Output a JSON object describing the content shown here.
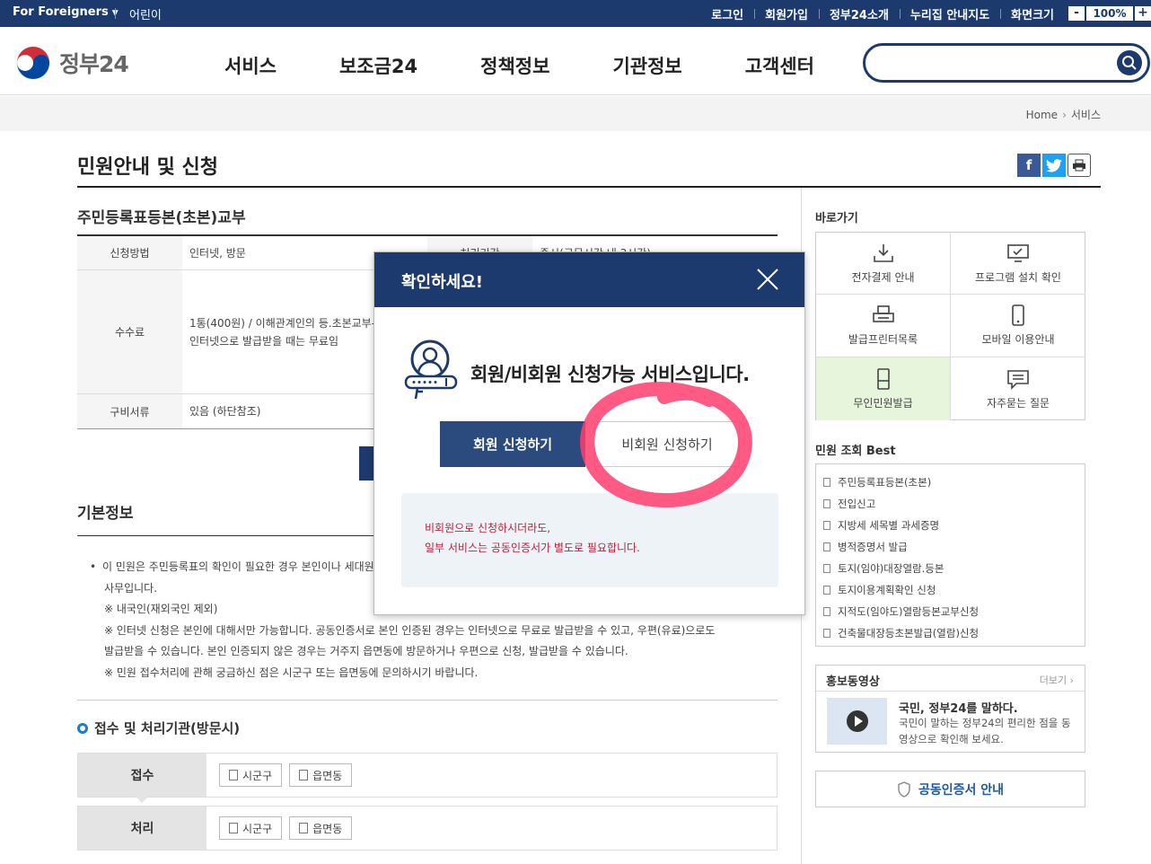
{
  "topbar": {
    "language": "For Foreigners",
    "kids": "어린이",
    "utilities": [
      "로그인",
      "회원가입",
      "정부24소개",
      "누리집 안내지도",
      "화면크기"
    ],
    "zoom": {
      "minus": "-",
      "value": "100%",
      "plus": "+"
    }
  },
  "header": {
    "logo_text": "정부24",
    "nav": [
      "서비스",
      "보조금24",
      "정책정보",
      "기관정보",
      "고객센터"
    ],
    "search_placeholder": ""
  },
  "breadcrumb": {
    "home": "Home",
    "current": "서비스"
  },
  "page": {
    "title": "민원안내 및 신청"
  },
  "service": {
    "title": "주민등록표등본(초본)교부",
    "rows": [
      {
        "label": "신청방법",
        "value": "인터넷, 방문",
        "extra_label": "처리기간",
        "extra_value": "즉시(근무시간 내 3시간)"
      },
      {
        "label": "수수료",
        "value_lines": [
          "1통(400원) / 이해관계인의 등.초본교부-",
          "인터넷으로 발급받을 때는 무료임"
        ]
      },
      {
        "label": "구비서류",
        "value": "있음 (하단참조)"
      }
    ]
  },
  "basic": {
    "title": "기본정보",
    "lines": [
      "이 민원은 주민등록표의 확인이 필요한 경우 본인이나 세대원 등이 주민등록표 등본·초본을 신청하여 발급받는",
      "사무입니다.",
      "※ 내국인(재외국인 제외)",
      "※ 인터넷 신청은 본인에 대해서만 가능합니다. 공동인증서로 본인 인증된 경우는 인터넷으로 무료로 발급받을 수 있고, 우편(유료)으로도",
      "발급받을 수 있습니다. 본인 인증되지 않은 경우는 거주지 읍면동에 방문하거나 우편으로 신청, 발급받을 수 있습니다.",
      "※ 민원 접수처리에 관해 궁금하신 점은 시군구 또는 읍면동에 문의하시기 바랍니다."
    ]
  },
  "process": {
    "title": "접수 및 처리기관(방문시)",
    "rows": [
      {
        "label": "접수",
        "chips": [
          "시군구",
          "읍면동"
        ]
      },
      {
        "label": "처리",
        "chips": [
          "시군구",
          "읍면동"
        ]
      }
    ]
  },
  "sidebar": {
    "quick_title": "바로가기",
    "quick": [
      "전자결제 안내",
      "프로그램 설치 확인",
      "발급프린터목록",
      "모바일 이용안내",
      "무인민원발급",
      "자주묻는 질문"
    ],
    "best_title": "민원 조회 Best",
    "best": [
      "주민등록표등본(초본)",
      "전입신고",
      "지방세 세목별 과세증명",
      "병적증명서 발급",
      "토지(임야)대장열람.등본",
      "토지이용계획확인 신청",
      "지적도(임야도)열람등본교부신청",
      "건축물대장등초본발급(열람)신청"
    ],
    "video": {
      "title": "홍보동영상",
      "more": "더보기",
      "headline": "국민, 정부24를 말하다.",
      "desc": "국민이 말하는 정부24의 편리한 점을 동영상으로 확인해 보세요."
    },
    "cert": "공동인증서 안내"
  },
  "modal": {
    "title": "확인하세요!",
    "message": "회원/비회원 신청가능 서비스입니다.",
    "member_button": "회원 신청하기",
    "guest_button": "비회원 신청하기",
    "notice_lines": [
      "비회원으로 신청하시더라도,",
      "일부 서비스는 공동인증서가 별도로 필요합니다."
    ]
  },
  "colors": {
    "brand": "#1c3a6e",
    "accent_circle": "#ff3d6e",
    "notice_text": "#c0203a",
    "highlight_bg": "#e7f5dc"
  }
}
